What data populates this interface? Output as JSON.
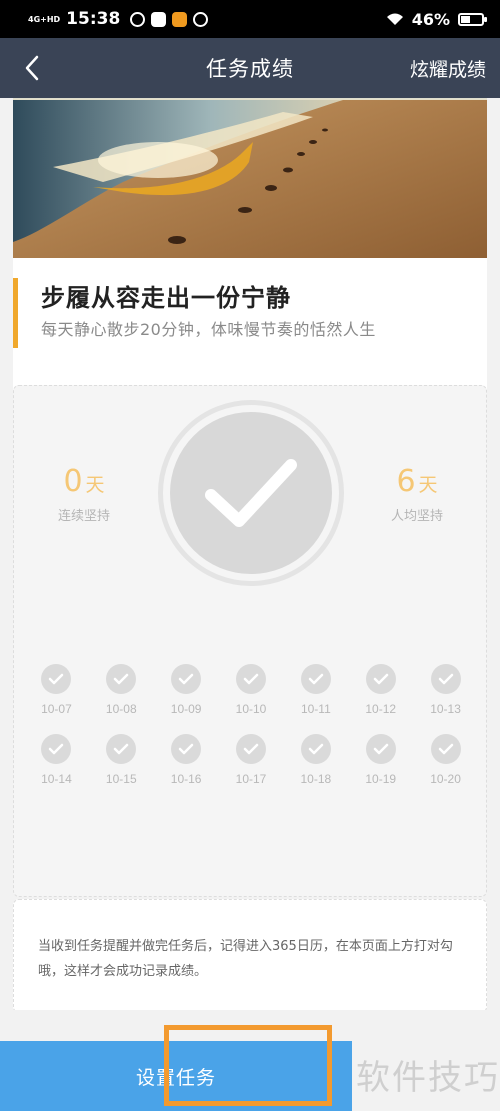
{
  "status_bar": {
    "network": "4G+HD",
    "time": "15:38",
    "battery_percent": "46%",
    "battery_level": 0.46
  },
  "header": {
    "title": "任务成绩",
    "right_link": "炫耀成绩"
  },
  "task": {
    "title": "步履从容走出一份宁静",
    "description": "每天静心散步20分钟，体味慢节奏的恬然人生"
  },
  "stats": {
    "streak_value": "0",
    "streak_unit": "天",
    "streak_label": "连续坚持",
    "avg_value": "6",
    "avg_unit": "天",
    "avg_label": "人均坚持"
  },
  "days": [
    "10-07",
    "10-08",
    "10-09",
    "10-10",
    "10-11",
    "10-12",
    "10-13",
    "10-14",
    "10-15",
    "10-16",
    "10-17",
    "10-18",
    "10-19",
    "10-20"
  ],
  "note": "当收到任务提醒并做完任务后，记得进入365日历，在本页面上方打对勾哦，这样才会成功记录成绩。",
  "bottom": {
    "set_task_label": "设置任务"
  },
  "watermark": "软件技巧",
  "colors": {
    "nav_bg": "#3a4456",
    "accent": "#f0a82c",
    "stat_color": "#f5c775",
    "button_blue": "#4aa3e8",
    "highlight": "#f39a2f"
  }
}
